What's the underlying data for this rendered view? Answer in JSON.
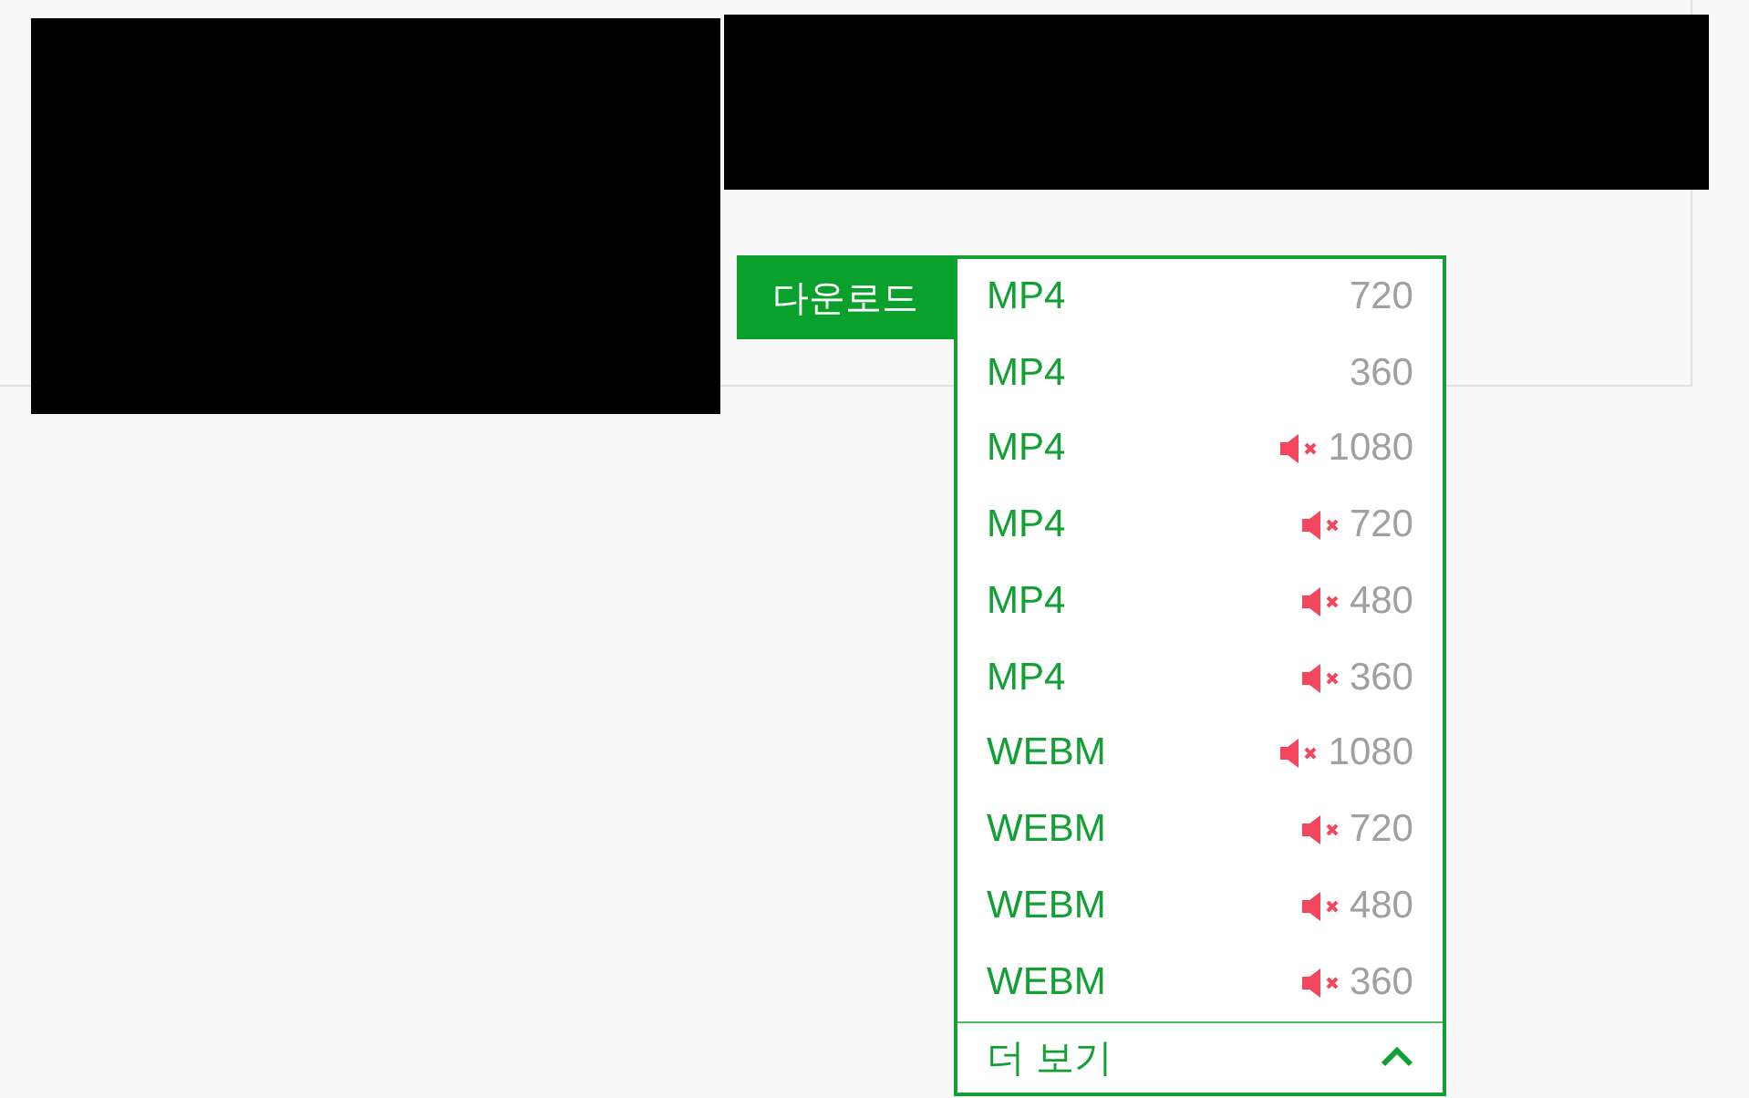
{
  "download_button": {
    "label": "다운로드"
  },
  "format_menu": {
    "open": true,
    "items": [
      {
        "format": "MP4",
        "resolution": "720",
        "muted": false
      },
      {
        "format": "MP4",
        "resolution": "360",
        "muted": false
      },
      {
        "format": "MP4",
        "resolution": "1080",
        "muted": true
      },
      {
        "format": "MP4",
        "resolution": "720",
        "muted": true
      },
      {
        "format": "MP4",
        "resolution": "480",
        "muted": true
      },
      {
        "format": "MP4",
        "resolution": "360",
        "muted": true
      },
      {
        "format": "WEBM",
        "resolution": "1080",
        "muted": true
      },
      {
        "format": "WEBM",
        "resolution": "720",
        "muted": true
      },
      {
        "format": "WEBM",
        "resolution": "480",
        "muted": true
      },
      {
        "format": "WEBM",
        "resolution": "360",
        "muted": true
      }
    ],
    "more_button": {
      "label": "더 보기"
    }
  }
}
